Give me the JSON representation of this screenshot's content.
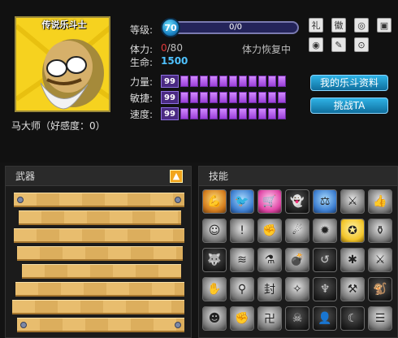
{
  "profile": {
    "title_badge": "传说乐斗士",
    "name_line": "马大师（好感度：0）"
  },
  "stats": {
    "level_label": "等级:",
    "level_value": "70",
    "exp_text": "0/0",
    "stamina_label": "体力:",
    "stamina_current": "0",
    "stamina_max": "/80",
    "recover_text": "体力恢复中",
    "life_label": "生命:",
    "life_value": "1500",
    "strength_label": "力量:",
    "strength_value": "99",
    "agility_label": "敏捷:",
    "agility_value": "99",
    "speed_label": "速度:",
    "speed_value": "99"
  },
  "toolbar_icons": [
    {
      "name": "gift-icon",
      "glyph": "礼"
    },
    {
      "name": "emblem-icon",
      "glyph": "徽"
    },
    {
      "name": "shield-icon",
      "glyph": "◎"
    },
    {
      "name": "bag-icon",
      "glyph": "▣"
    },
    {
      "name": "badge-icon",
      "glyph": "◉"
    },
    {
      "name": "scroll-icon",
      "glyph": "✎"
    },
    {
      "name": "target-icon",
      "glyph": "⊙"
    }
  ],
  "buttons": {
    "profile_btn": "我的乐斗资料",
    "challenge_btn": "挑战TA"
  },
  "panels": {
    "weapons_title": "武器",
    "skills_title": "技能"
  },
  "skills": [
    {
      "name": "muscle-skill-icon",
      "glyph": "💪",
      "tone": "color"
    },
    {
      "name": "bird-skill-icon",
      "glyph": "🐦",
      "tone": "blue"
    },
    {
      "name": "stroller-skill-icon",
      "glyph": "🛒",
      "tone": "pink"
    },
    {
      "name": "dark-spirit-skill-icon",
      "glyph": "👻",
      "tone": "dark"
    },
    {
      "name": "scale-skill-icon",
      "glyph": "⚖",
      "tone": "blue"
    },
    {
      "name": "crossed-swords-skill-icon",
      "glyph": "⚔",
      "tone": ""
    },
    {
      "name": "thumbs-skill-icon",
      "glyph": "👍",
      "tone": ""
    },
    {
      "name": "body-skill-icon",
      "glyph": "☺",
      "tone": ""
    },
    {
      "name": "shield-skill-icon",
      "glyph": "!",
      "tone": ""
    },
    {
      "name": "fist-skill-icon",
      "glyph": "✊",
      "tone": ""
    },
    {
      "name": "fire-skill-icon",
      "glyph": "☄",
      "tone": ""
    },
    {
      "name": "burst-skill-icon",
      "glyph": "✹",
      "tone": ""
    },
    {
      "name": "golden-skill-icon",
      "glyph": "✪",
      "tone": "yellow"
    },
    {
      "name": "sack-skill-icon",
      "glyph": "⚱",
      "tone": ""
    },
    {
      "name": "wolf-skill-icon",
      "glyph": "🐺",
      "tone": "dark"
    },
    {
      "name": "wave-skill-icon",
      "glyph": "≋",
      "tone": ""
    },
    {
      "name": "bottle-skill-icon",
      "glyph": "⚗",
      "tone": ""
    },
    {
      "name": "bomb-skill-icon",
      "glyph": "💣",
      "tone": ""
    },
    {
      "name": "reflect-skill-icon",
      "glyph": "↺",
      "tone": "dark"
    },
    {
      "name": "daze-skill-icon",
      "glyph": "✱",
      "tone": ""
    },
    {
      "name": "sword-skill-icon",
      "glyph": "⚔",
      "tone": ""
    },
    {
      "name": "punch-skill-icon",
      "glyph": "✋",
      "tone": ""
    },
    {
      "name": "potion-skill-icon",
      "glyph": "⚲",
      "tone": ""
    },
    {
      "name": "seal-skill-icon",
      "glyph": "封",
      "tone": ""
    },
    {
      "name": "wing-skill-icon",
      "glyph": "✧",
      "tone": ""
    },
    {
      "name": "horn-skill-icon",
      "glyph": "♆",
      "tone": "dark"
    },
    {
      "name": "blade-skill-icon",
      "glyph": "⚒",
      "tone": ""
    },
    {
      "name": "monkey-skill-icon",
      "glyph": "🐒",
      "tone": "dark"
    },
    {
      "name": "head-skill-icon",
      "glyph": "☻",
      "tone": ""
    },
    {
      "name": "claw-skill-icon",
      "glyph": "✊",
      "tone": ""
    },
    {
      "name": "sigil-skill-icon",
      "glyph": "卍",
      "tone": ""
    },
    {
      "name": "demon-skill-icon",
      "glyph": "☠",
      "tone": "dark"
    },
    {
      "name": "ghost-skill-icon",
      "glyph": "👤",
      "tone": "dark"
    },
    {
      "name": "crescent-skill-icon",
      "glyph": "☾",
      "tone": "dark"
    },
    {
      "name": "stripe-skill-icon",
      "glyph": "☰",
      "tone": ""
    }
  ],
  "colors": {
    "accent_blue": "#2fb3e6",
    "stat_purple": "#9a3fd8",
    "stamina_red": "#e03a3a",
    "life_blue": "#4fc2ff"
  }
}
